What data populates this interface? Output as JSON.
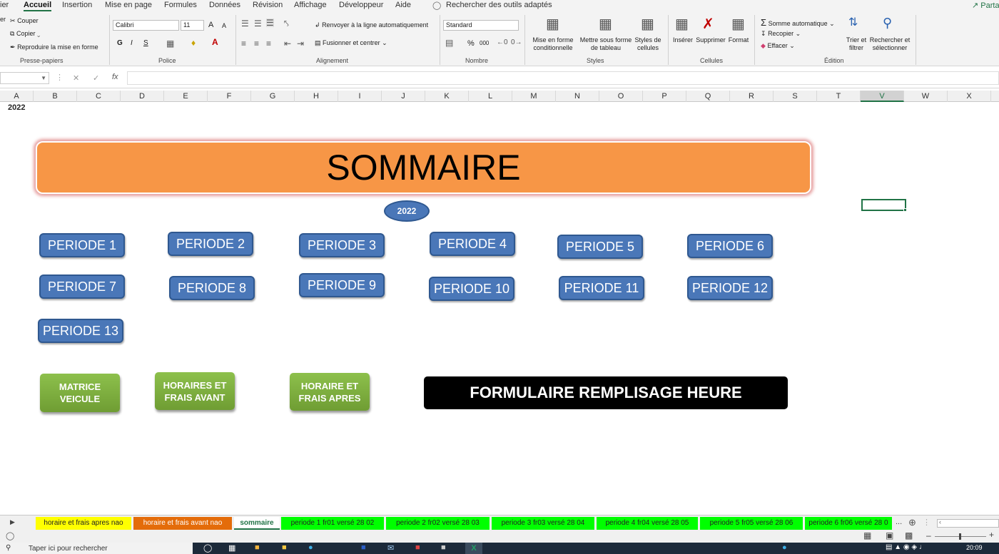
{
  "ribbon_tabs": [
    "ier",
    "Accueil",
    "Insertion",
    "Mise en page",
    "Formules",
    "Données",
    "Révision",
    "Affichage",
    "Développeur",
    "Aide"
  ],
  "search_tools": "Rechercher des outils adaptés",
  "share": "Parta",
  "clipboard": {
    "cut": "Couper",
    "copy": "Copier",
    "format_painter": "Reproduire la mise en forme",
    "group": "Presse-papiers",
    "paste_fragment": "er"
  },
  "font": {
    "name": "Calibri",
    "size": "11",
    "bold": "G",
    "italic": "I",
    "underline": "S",
    "grow": "A",
    "shrink": "A",
    "group": "Police"
  },
  "alignment": {
    "wrap": "Renvoyer à la ligne automatiquement",
    "merge": "Fusionner et centrer",
    "group": "Alignement"
  },
  "number": {
    "format": "Standard",
    "percent": "%",
    "thousands": "000",
    "group": "Nombre"
  },
  "styles": {
    "cond": "Mise en forme\nconditionnelle",
    "table": "Mettre sous forme\nde tableau",
    "cell": "Styles de\ncellules",
    "group": "Styles"
  },
  "cells": {
    "insert": "Insérer",
    "delete": "Supprimer",
    "format": "Format",
    "group": "Cellules"
  },
  "editing": {
    "autosum": "Somme automatique",
    "fill": "Recopier",
    "clear": "Effacer",
    "sort": "Trier et\nfiltrer",
    "find": "Rechercher et\nsélectionner",
    "group": "Édition"
  },
  "formula_bar": {
    "fx": "fx",
    "cancel": "✕",
    "confirm": "✓",
    "value": ""
  },
  "columns": [
    "A",
    "B",
    "C",
    "D",
    "E",
    "F",
    "G",
    "H",
    "I",
    "J",
    "K",
    "L",
    "M",
    "N",
    "O",
    "P",
    "Q",
    "R",
    "S",
    "T",
    "V",
    "W",
    "X"
  ],
  "selected_column": "V",
  "cell_a1": "2022",
  "sheet": {
    "title": "SOMMAIRE",
    "year_badge": "2022",
    "periods": [
      "PERIODE 1",
      "PERIODE  2",
      "PERIODE 3",
      "PERIODE 4",
      "PERIODE 5",
      "PERIODE  6",
      "PERIODE 7",
      "PERIODE 8",
      "PERIODE 9",
      "PERIODE 10",
      "PERIODE 11",
      "PERIODE 12",
      "PERIODE 13"
    ],
    "green_buttons": [
      "MATRICE\nVEICULE",
      "HORAIRES ET\nFRAIS AVANT",
      "HORAIRE ET\nFRAIS APRES"
    ],
    "form_button": "FORMULAIRE REMPLISAGE HEURE"
  },
  "sheet_tabs": [
    {
      "label": "horaire et frais apres nao",
      "color": "#ffff00"
    },
    {
      "label": "horaire et frais avant nao",
      "color": "#e46c0a"
    },
    {
      "label": "sommaire",
      "color": "#ffffff"
    },
    {
      "label": "periode 1  fr01 versé 28  02",
      "color": "#00ff00"
    },
    {
      "label": "periode 2  fr02 versé 28  03",
      "color": "#00ff00"
    },
    {
      "label": "periode 3  fr03 versé 28  04",
      "color": "#00ff00"
    },
    {
      "label": "periode 4 fr04 versé 28  05",
      "color": "#00ff00"
    },
    {
      "label": "periode 5  fr05 versé 28  06",
      "color": "#00ff00"
    },
    {
      "label": "periode 6 fr06 versé 28 0",
      "color": "#00ff00"
    }
  ],
  "more_tabs": "...",
  "taskbar": {
    "search": "Taper ici pour rechercher",
    "time": "20:09"
  }
}
